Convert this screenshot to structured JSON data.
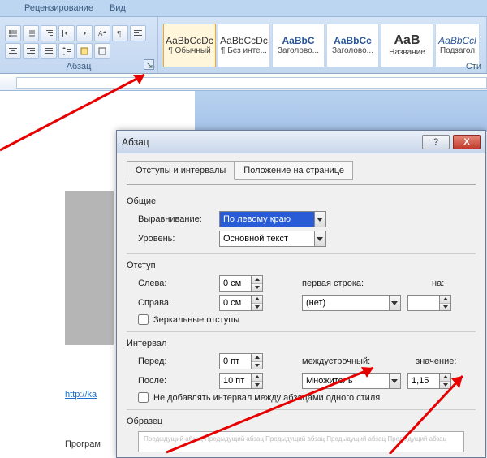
{
  "ribbon_tabs": {
    "review": "Рецензирование",
    "view": "Вид"
  },
  "ribbon": {
    "paragraph_group": "Абзац",
    "styles_group": "Сти",
    "styles": [
      {
        "sample": "AaBbCcDc",
        "name": "¶ Обычный"
      },
      {
        "sample": "AaBbCcDc",
        "name": "¶ Без инте..."
      },
      {
        "sample": "AaBbC",
        "name": "Заголово..."
      },
      {
        "sample": "AaBbCc",
        "name": "Заголово..."
      },
      {
        "sample": "AaB",
        "name": "Название"
      },
      {
        "sample": "AaBbCcl",
        "name": "Подзагол"
      }
    ]
  },
  "dialog": {
    "title": "Абзац",
    "tabs": {
      "indents": "Отступы и интервалы",
      "page_pos": "Положение на странице"
    },
    "sections": {
      "general": "Общие",
      "indent": "Отступ",
      "spacing": "Интервал",
      "preview": "Образец"
    },
    "labels": {
      "alignment": "Выравнивание:",
      "level": "Уровень:",
      "left": "Слева:",
      "right": "Справа:",
      "first_line": "первая строка:",
      "by": "на:",
      "mirror": "Зеркальные отступы",
      "before": "Перед:",
      "after": "После:",
      "line_spacing": "междустрочный:",
      "value": "значение:",
      "no_space": "Не добавлять интервал между абзацами одного стиля"
    },
    "values": {
      "alignment": "По левому краю",
      "level": "Основной текст",
      "left": "0 см",
      "right": "0 см",
      "first_line": "(нет)",
      "by": "",
      "before": "0 пт",
      "after": "10 пт",
      "line_spacing": "Множитель",
      "value": "1,15"
    },
    "help": "?",
    "close": "X"
  },
  "page": {
    "url": "http://ka",
    "program": "Програм"
  }
}
